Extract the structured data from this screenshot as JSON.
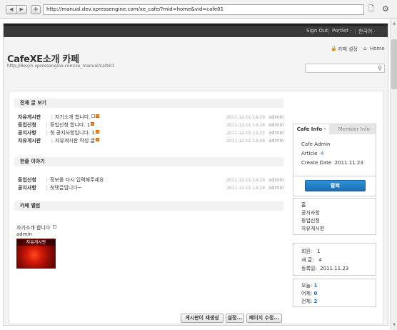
{
  "browser": {
    "url": "http://manual.dev.xpressengine.com/xe_cafe/?mid=home&vid=cafe01",
    "back_glyph": "◀",
    "forward_glyph": "▶",
    "plus_glyph": "+"
  },
  "gnb": {
    "sign_out": "Sign Out",
    "portlet": "Portlet ·",
    "language": "한국어 ·"
  },
  "site": {
    "title": "CafeXE소개 카페",
    "url": "http://devjin.xpressengine.com/xe_manual/cafe01",
    "settings_link": "카페 설정",
    "home_link": "Home"
  },
  "sections": {
    "all_posts": "전체 글 보기",
    "one_liner": "한줄 이야기",
    "album": "카페 앨범"
  },
  "all_posts": [
    {
      "category": "자유게시판",
      "title": "자기소개 합니다.",
      "date": "2011-12-01 14:29",
      "author": "admin",
      "badges": [
        "img",
        "new"
      ]
    },
    {
      "category": "등업신청",
      "title": "등업신청 합니다.",
      "comments": "1",
      "date": "2011-12-01 14:28",
      "author": "admin",
      "badges": [
        "new"
      ]
    },
    {
      "category": "공지사항",
      "title": "첫 공지사항입니다.",
      "comments": "1",
      "date": "2011-12-01 14:25",
      "author": "admin",
      "badges": [
        "new"
      ]
    },
    {
      "category": "자유게시판",
      "title": "자유게시판 작성 글",
      "date": "2011-12-01 14:08",
      "author": "admin",
      "badges": [
        "new"
      ]
    }
  ],
  "one_liners": [
    {
      "category": "등업신청",
      "title": "정보를 다시 입력해주세요",
      "date": "2011-12-01 14:29",
      "author": "admin"
    },
    {
      "category": "공지사항",
      "title": "첫댓글입니다~",
      "date": "2011-12-01 14:28",
      "author": "admin"
    }
  ],
  "album": {
    "caption": "자기소개 합니다",
    "author": "admin",
    "thumb_label": "자유게시판"
  },
  "actions": {
    "board_create": "게시판이 재생성",
    "settings": "설정...",
    "page_edit": "페이지 수정..."
  },
  "sidebar": {
    "tab_cafe_info": "Cafe Info ·",
    "tab_member_info": "Member Info ·",
    "admin_label": "Cafe Admin",
    "article_label": "Article",
    "article_value": "4",
    "create_date_label": "Create Date",
    "create_date_value": "2011.11.23",
    "join_button": "탈퇴",
    "menu": [
      "홈",
      "공지사항",
      "등업신청",
      "자유게시판"
    ],
    "members_label": "회원:",
    "members_value": "1",
    "posts_label": "새 글:",
    "posts_value": "4",
    "reg_label": "등록일:",
    "reg_value": "2011.11.23",
    "today_label": "오늘:",
    "today_value": "1",
    "yesterday_label": "어제:",
    "yesterday_value": "0",
    "total_label": "전체:",
    "total_value": "2"
  },
  "colors": {
    "gnb_bg": "#3a3a3a",
    "link_blue": "#2b7bbd",
    "button_blue": "#1a6fb5",
    "new_badge": "#f08a2a"
  }
}
